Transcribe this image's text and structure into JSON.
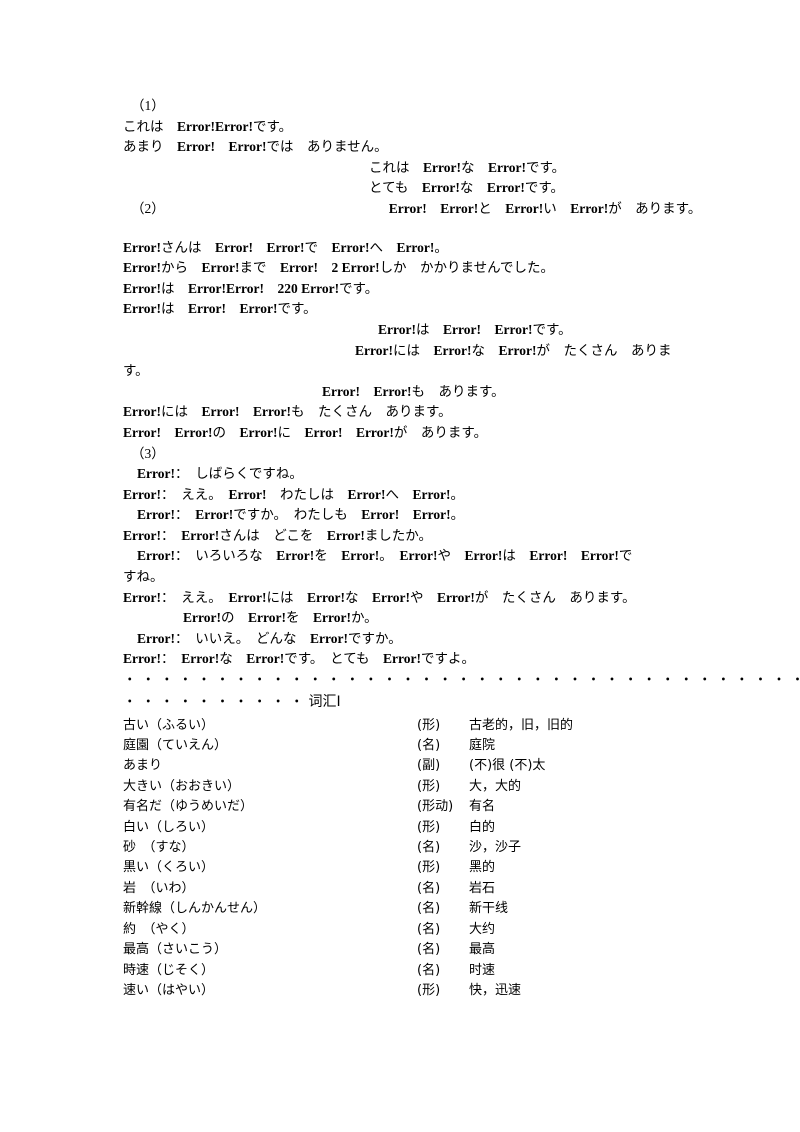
{
  "document": {
    "language": "ja-zh",
    "sections": {
      "exercise1": {
        "number": "（1）",
        "lines": [
          {
            "indent": "ind-0",
            "text": "これは　Error!Error!です。"
          },
          {
            "indent": "ind-0",
            "text": "あまり　Error!　Error!では　ありません。"
          },
          {
            "indent": "ind-far",
            "text": "これは　Error!な　Error!です。"
          },
          {
            "indent": "ind-far",
            "text": "とても　Error!な　Error!です。"
          }
        ]
      },
      "exercise2": {
        "number": "（2）",
        "number_line_tail": "Error!　Error!と　Error!い　Error!が　あります。",
        "lines": [
          {
            "indent": "ind-0",
            "text": "Error!さんは　Error!　Error!で　Error!へ　Error!。"
          },
          {
            "indent": "ind-0",
            "text": "Error!から　Error!まで　Error!　2 Error!しか　かかりませんでした。"
          },
          {
            "indent": "ind-0",
            "text": "Error!は　Error!Error!　220 Error!です。"
          },
          {
            "indent": "ind-0",
            "text": "Error!は　Error!　Error!です。"
          },
          {
            "indent": "ind-far3",
            "text": "Error!は　Error!　Error!です。"
          },
          {
            "indent": "ind-far2",
            "text": "Error!には　Error!な　Error!が　たくさん　ありま"
          },
          {
            "indent": "ind-0",
            "text": "す。"
          },
          {
            "indent": "ind-far4",
            "text": "Error!　Error!も　あります。"
          },
          {
            "indent": "ind-0",
            "text": "Error!には　Error!　Error!も　たくさん　あります。"
          },
          {
            "indent": "ind-0",
            "text": "Error!　Error!の　Error!に　Error!　Error!が　あります。"
          }
        ]
      },
      "exercise3": {
        "number": "（3）",
        "lines": [
          {
            "indent": "ind-2",
            "text": "Error!：　しばらくですね。"
          },
          {
            "indent": "ind-0",
            "text": "Error!：　ええ。　Error!　わたしは　Error!へ　Error!。"
          },
          {
            "indent": "ind-2",
            "text": "Error!：　Error!ですか。　わたしも　Error!　Error!。"
          },
          {
            "indent": "ind-0",
            "text": "Error!：　Error!さんは　どこを　Error!ましたか。"
          },
          {
            "indent": "ind-2",
            "text": "Error!：　いろいろな　Error!を　Error!。　Error!や　Error!は　Error!　Error!で"
          },
          {
            "indent": "ind-0",
            "text": "すね。"
          },
          {
            "indent": "ind-0",
            "text": "Error!：　ええ。　Error!には　Error!な　Error!や　Error!が　たくさん　あります。"
          },
          {
            "indent": "ind-mid",
            "text": "Error!の　Error!を　Error!か。"
          },
          {
            "indent": "ind-2",
            "text": "Error!：　いいえ。　どんな　Error!ですか。"
          },
          {
            "indent": "ind-0",
            "text": "Error!：　Error!な　Error!です。　とても　Error!ですよ。"
          }
        ]
      },
      "separator": {
        "dots_full": "・・・・・・・・・・・・・・・・・・・・・・・・・・・・・・・・・・・・・・・・・・・・・・・・・・・・・・・・・・・",
        "dots_partial": "・・・・・・・・・・",
        "vocab_heading": "词汇Ⅰ"
      },
      "vocabulary": {
        "columns": [
          "word",
          "pos",
          "meaning"
        ],
        "entries": [
          {
            "word": "古い（ふるい）",
            "pos": "(形)",
            "meaning": "古老的，旧，旧的"
          },
          {
            "word": "庭園（ていえん）",
            "pos": "(名)",
            "meaning": "庭院"
          },
          {
            "word": "あまり",
            "pos": "(副)",
            "meaning": "(不)很 (不)太"
          },
          {
            "word": "大きい（おおきい）",
            "pos": "(形)",
            "meaning": "大，大的"
          },
          {
            "word": "有名だ（ゆうめいだ）",
            "pos": "(形动)",
            "meaning": "有名"
          },
          {
            "word": "白い（しろい）",
            "pos": "(形)",
            "meaning": "白的"
          },
          {
            "word": "砂　（すな）",
            "pos": "(名)",
            "meaning": "沙，沙子"
          },
          {
            "word": "黒い（くろい）",
            "pos": "(形)",
            "meaning": "黑的"
          },
          {
            "word": "岩　（いわ）",
            "pos": "(名)",
            "meaning": "岩石"
          },
          {
            "word": "新幹線（しんかんせん）",
            "pos": "(名)",
            "meaning": "新干线"
          },
          {
            "word": "約　（やく）",
            "pos": "(名)",
            "meaning": "大约"
          },
          {
            "word": "最高（さいこう）",
            "pos": "(名)",
            "meaning": "最高"
          },
          {
            "word": "時速（じそく）",
            "pos": "(名)",
            "meaning": "时速"
          },
          {
            "word": "速い（はやい）",
            "pos": "(形)",
            "meaning": "快，迅速"
          }
        ]
      }
    }
  }
}
